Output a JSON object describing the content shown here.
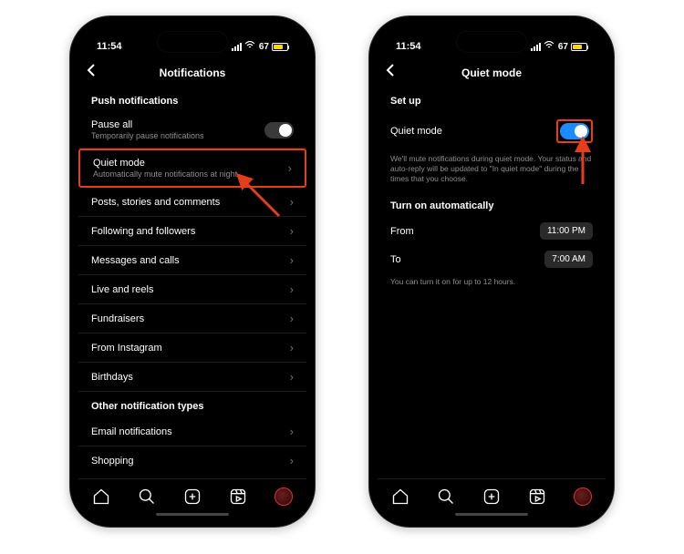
{
  "statusbar": {
    "time": "11:54",
    "battery": "67"
  },
  "left": {
    "title": "Notifications",
    "section1": "Push notifications",
    "pause": {
      "label": "Pause all",
      "sub": "Temporarily pause notifications"
    },
    "quiet": {
      "label": "Quiet mode",
      "sub": "Automatically mute notifications at night"
    },
    "items": [
      "Posts, stories and comments",
      "Following and followers",
      "Messages and calls",
      "Live and reels",
      "Fundraisers",
      "From Instagram",
      "Birthdays"
    ],
    "section2": "Other notification types",
    "items2": [
      "Email notifications",
      "Shopping"
    ]
  },
  "right": {
    "title": "Quiet mode",
    "section1": "Set up",
    "toggle_label": "Quiet mode",
    "desc": "We'll mute notifications during quiet mode. Your status and auto-reply will be updated to \"In quiet mode\" during the times that you choose.",
    "section2": "Turn on automatically",
    "from_label": "From",
    "from_time": "11:00 PM",
    "to_label": "To",
    "to_time": "7:00 AM",
    "note": "You can turn it on for up to 12 hours."
  }
}
